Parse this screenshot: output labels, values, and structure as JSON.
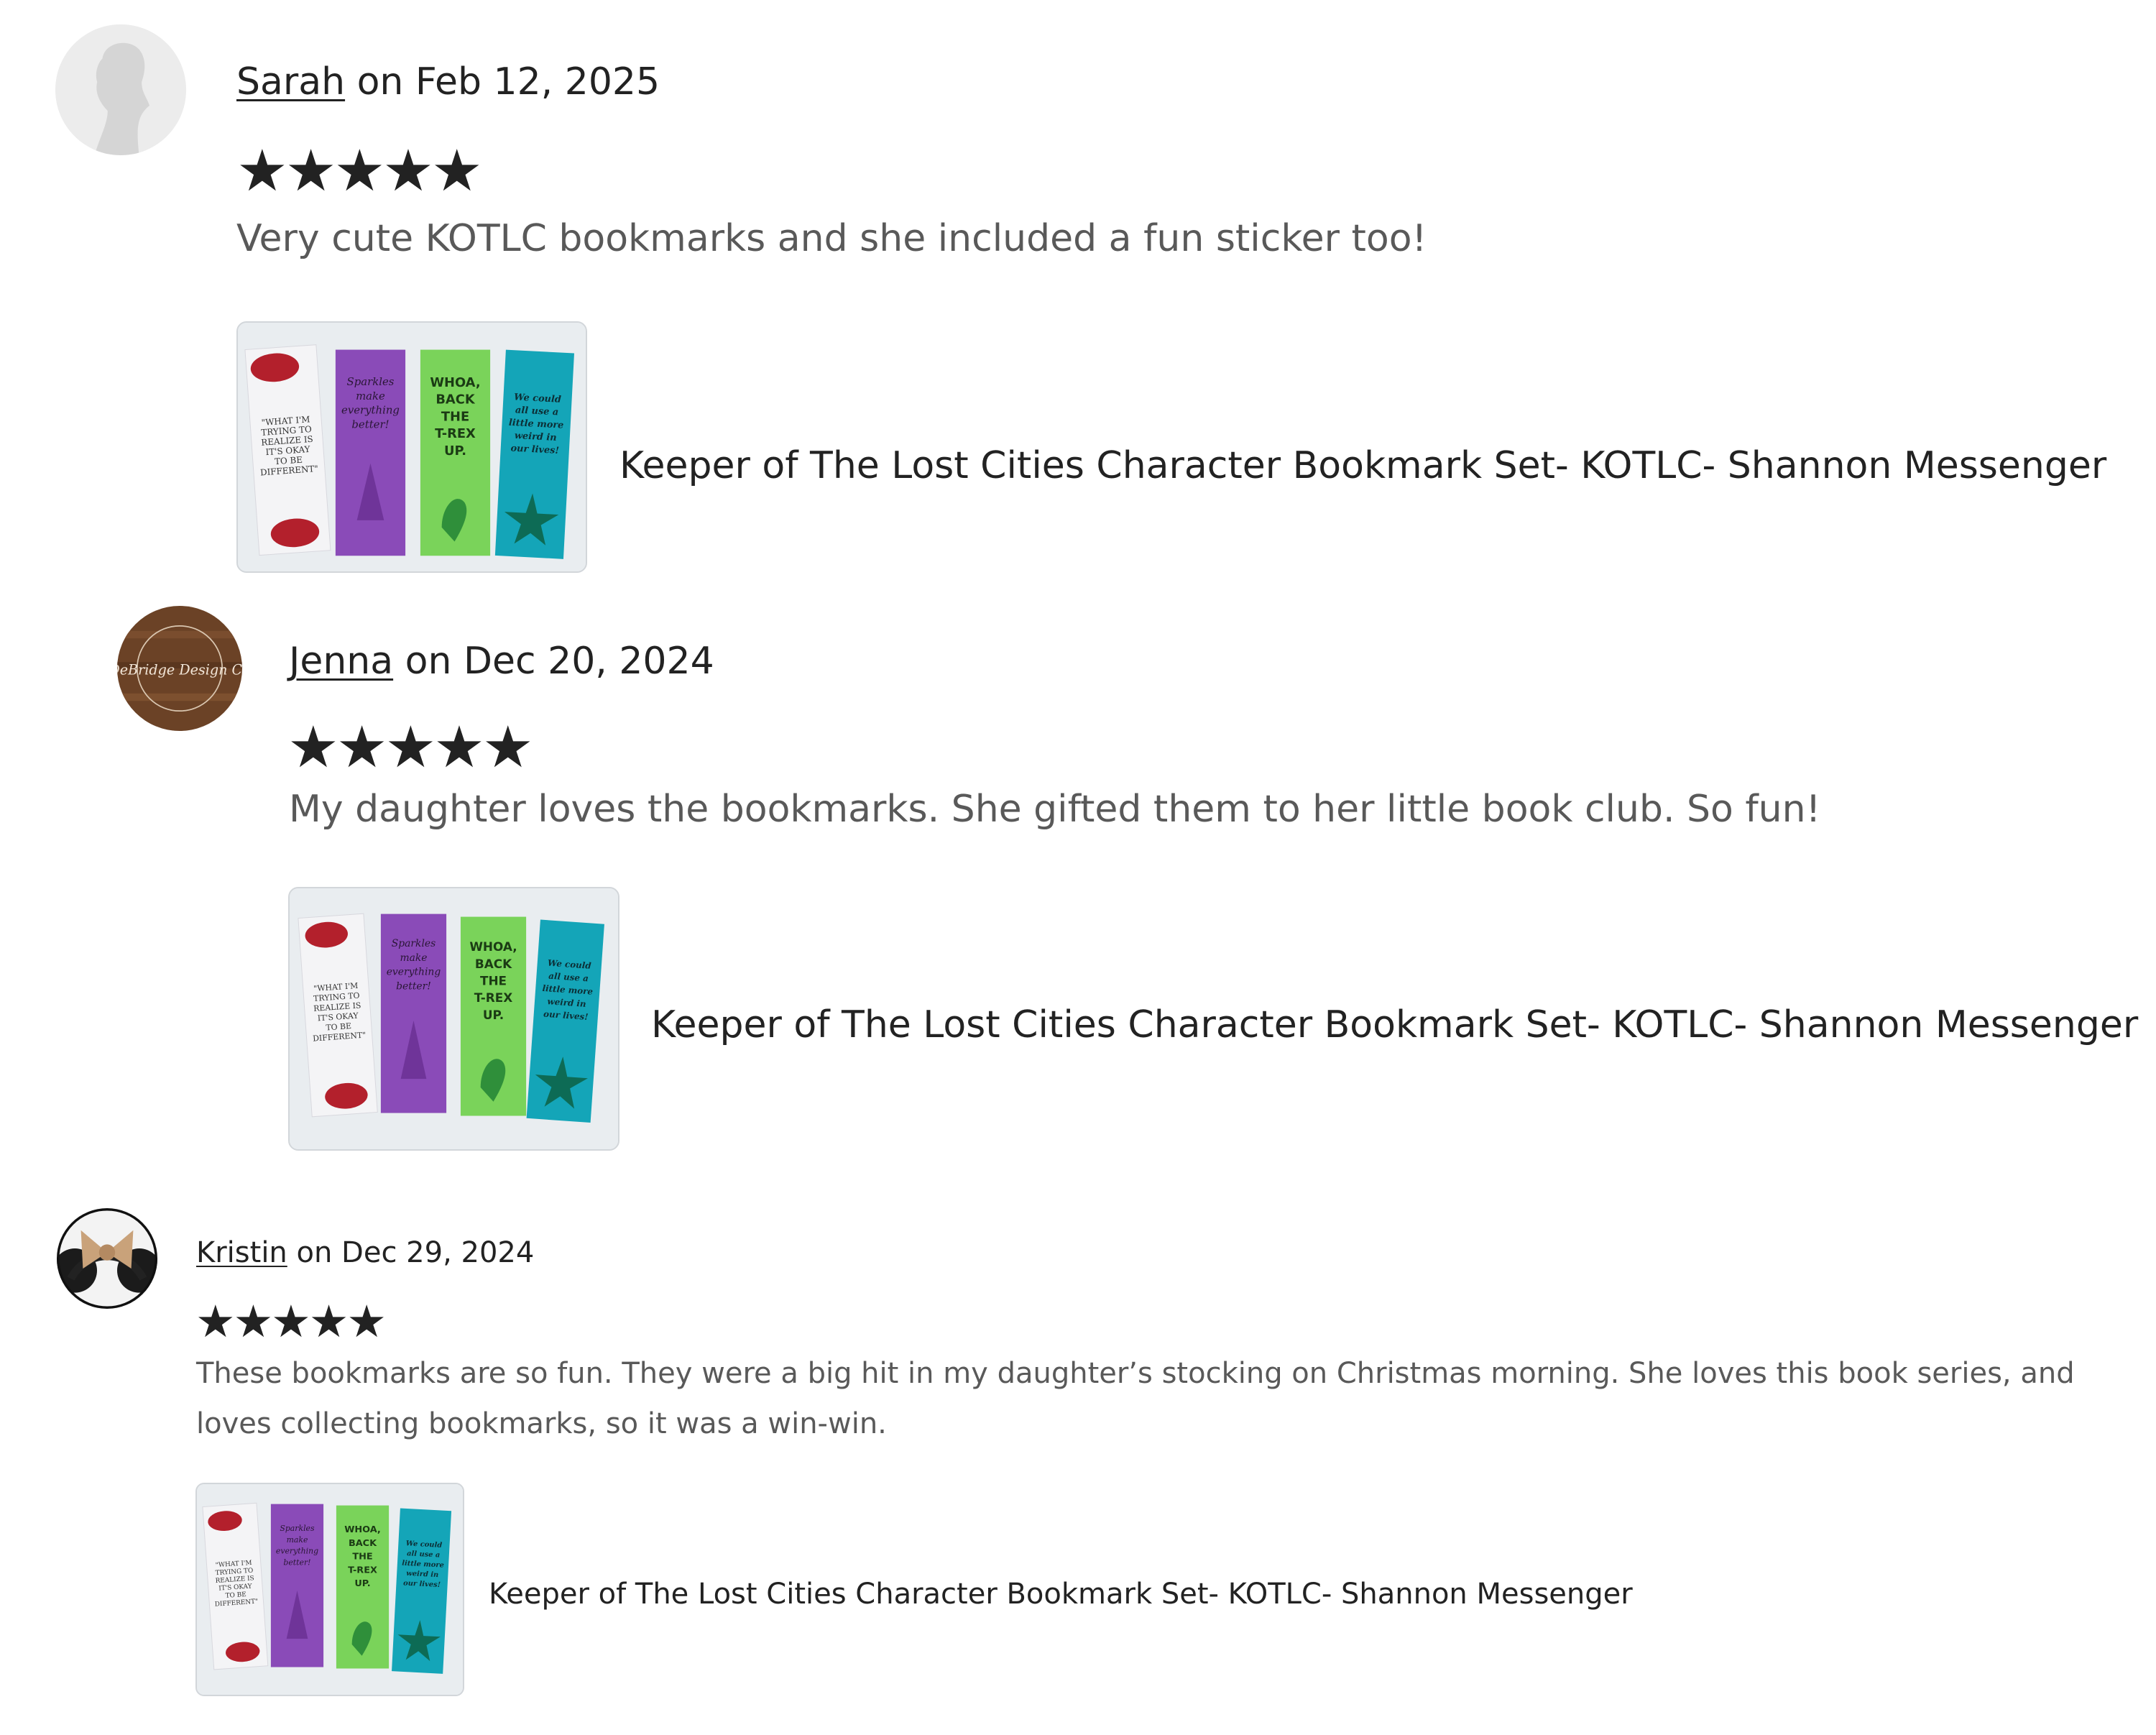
{
  "reviews": [
    {
      "reviewer": "Sarah",
      "date_prefix": "on",
      "date": "Feb 12, 2025",
      "rating": 5,
      "stars": "★★★★★",
      "text": "Very cute KOTLC bookmarks and she included a fun sticker too!",
      "listing_title": "Keeper of The Lost Cities Character Bookmark Set- KOTLC- Shannon Messenger",
      "avatar": "default-silhouette"
    },
    {
      "reviewer": "Jenna",
      "date_prefix": "on",
      "date": "Dec 20, 2024",
      "rating": 5,
      "stars": "★★★★★",
      "text": "My daughter loves the bookmarks. She gifted them to her little book club. So fun!",
      "listing_title": "Keeper of The Lost Cities Character Bookmark Set- KOTLC- Shannon Messenger",
      "avatar": "wood-logo",
      "avatar_text": "DeBridge Design Co"
    },
    {
      "reviewer": "Kristin",
      "date_prefix": "on",
      "date": "Dec 29, 2024",
      "rating": 5,
      "stars": "★★★★★",
      "text": "These bookmarks are so fun. They were a big hit in my daughter’s stocking on Christmas morning. She loves this book series, and loves collecting bookmarks, so it was a win-win.",
      "listing_title": "Keeper of The Lost Cities Character Bookmark Set- KOTLC- Shannon Messenger",
      "avatar": "mouse-ears-photo"
    }
  ],
  "bookmarks": {
    "b1": [
      "\"WHAT I'M",
      "TRYING TO",
      "REALIZE IS",
      "IT'S OKAY",
      "TO BE",
      "DIFFERENT\""
    ],
    "b2": [
      "Sparkles",
      "make",
      "everything",
      "better!"
    ],
    "b3": [
      "WHOA,",
      "BACK",
      "THE",
      "T-REX",
      "UP."
    ],
    "b4": [
      "We could",
      "all use a",
      "little more",
      "weird in",
      "our lives!"
    ]
  },
  "colors": {
    "text": "#222222",
    "muted": "#595959",
    "bm_white": "#f4f4f6",
    "bm_purple": "#8a4bb8",
    "bm_green": "#7ad35a",
    "bm_teal": "#14a5b8",
    "avatar_wood": "#6b4226"
  }
}
